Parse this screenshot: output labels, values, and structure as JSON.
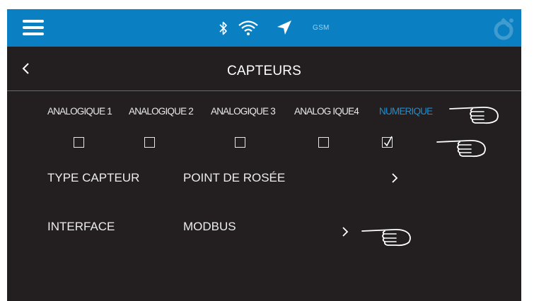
{
  "header": {
    "status_label": "GSM"
  },
  "title_bar": {
    "title": "CAPTEURS"
  },
  "tabs": [
    {
      "label": "ANALOGIQUE 1",
      "active": false
    },
    {
      "label": "ANALOGIQUE 2",
      "active": false
    },
    {
      "label": "ANALOGIQUE 3",
      "active": false
    },
    {
      "label": "ANALOG IQUE4",
      "active": false
    },
    {
      "label": "NUMERIQUE",
      "active": true
    }
  ],
  "checkboxes": [
    false,
    false,
    false,
    false,
    true
  ],
  "settings": [
    {
      "label": "TYPE CAPTEUR",
      "value": "POINT DE ROSÉE"
    },
    {
      "label": "INTERFACE",
      "value": "MODBUS"
    }
  ],
  "colors": {
    "header_bg": "#0a7fc2",
    "screen_bg": "#231f20",
    "active_tab": "#1a8fd3",
    "text": "#ececec"
  },
  "icons": [
    "menu-icon",
    "bluetooth-icon",
    "wifi-icon",
    "location-arrow-icon",
    "back-chevron-icon",
    "chevron-right-icon",
    "pointing-hand-icon"
  ]
}
